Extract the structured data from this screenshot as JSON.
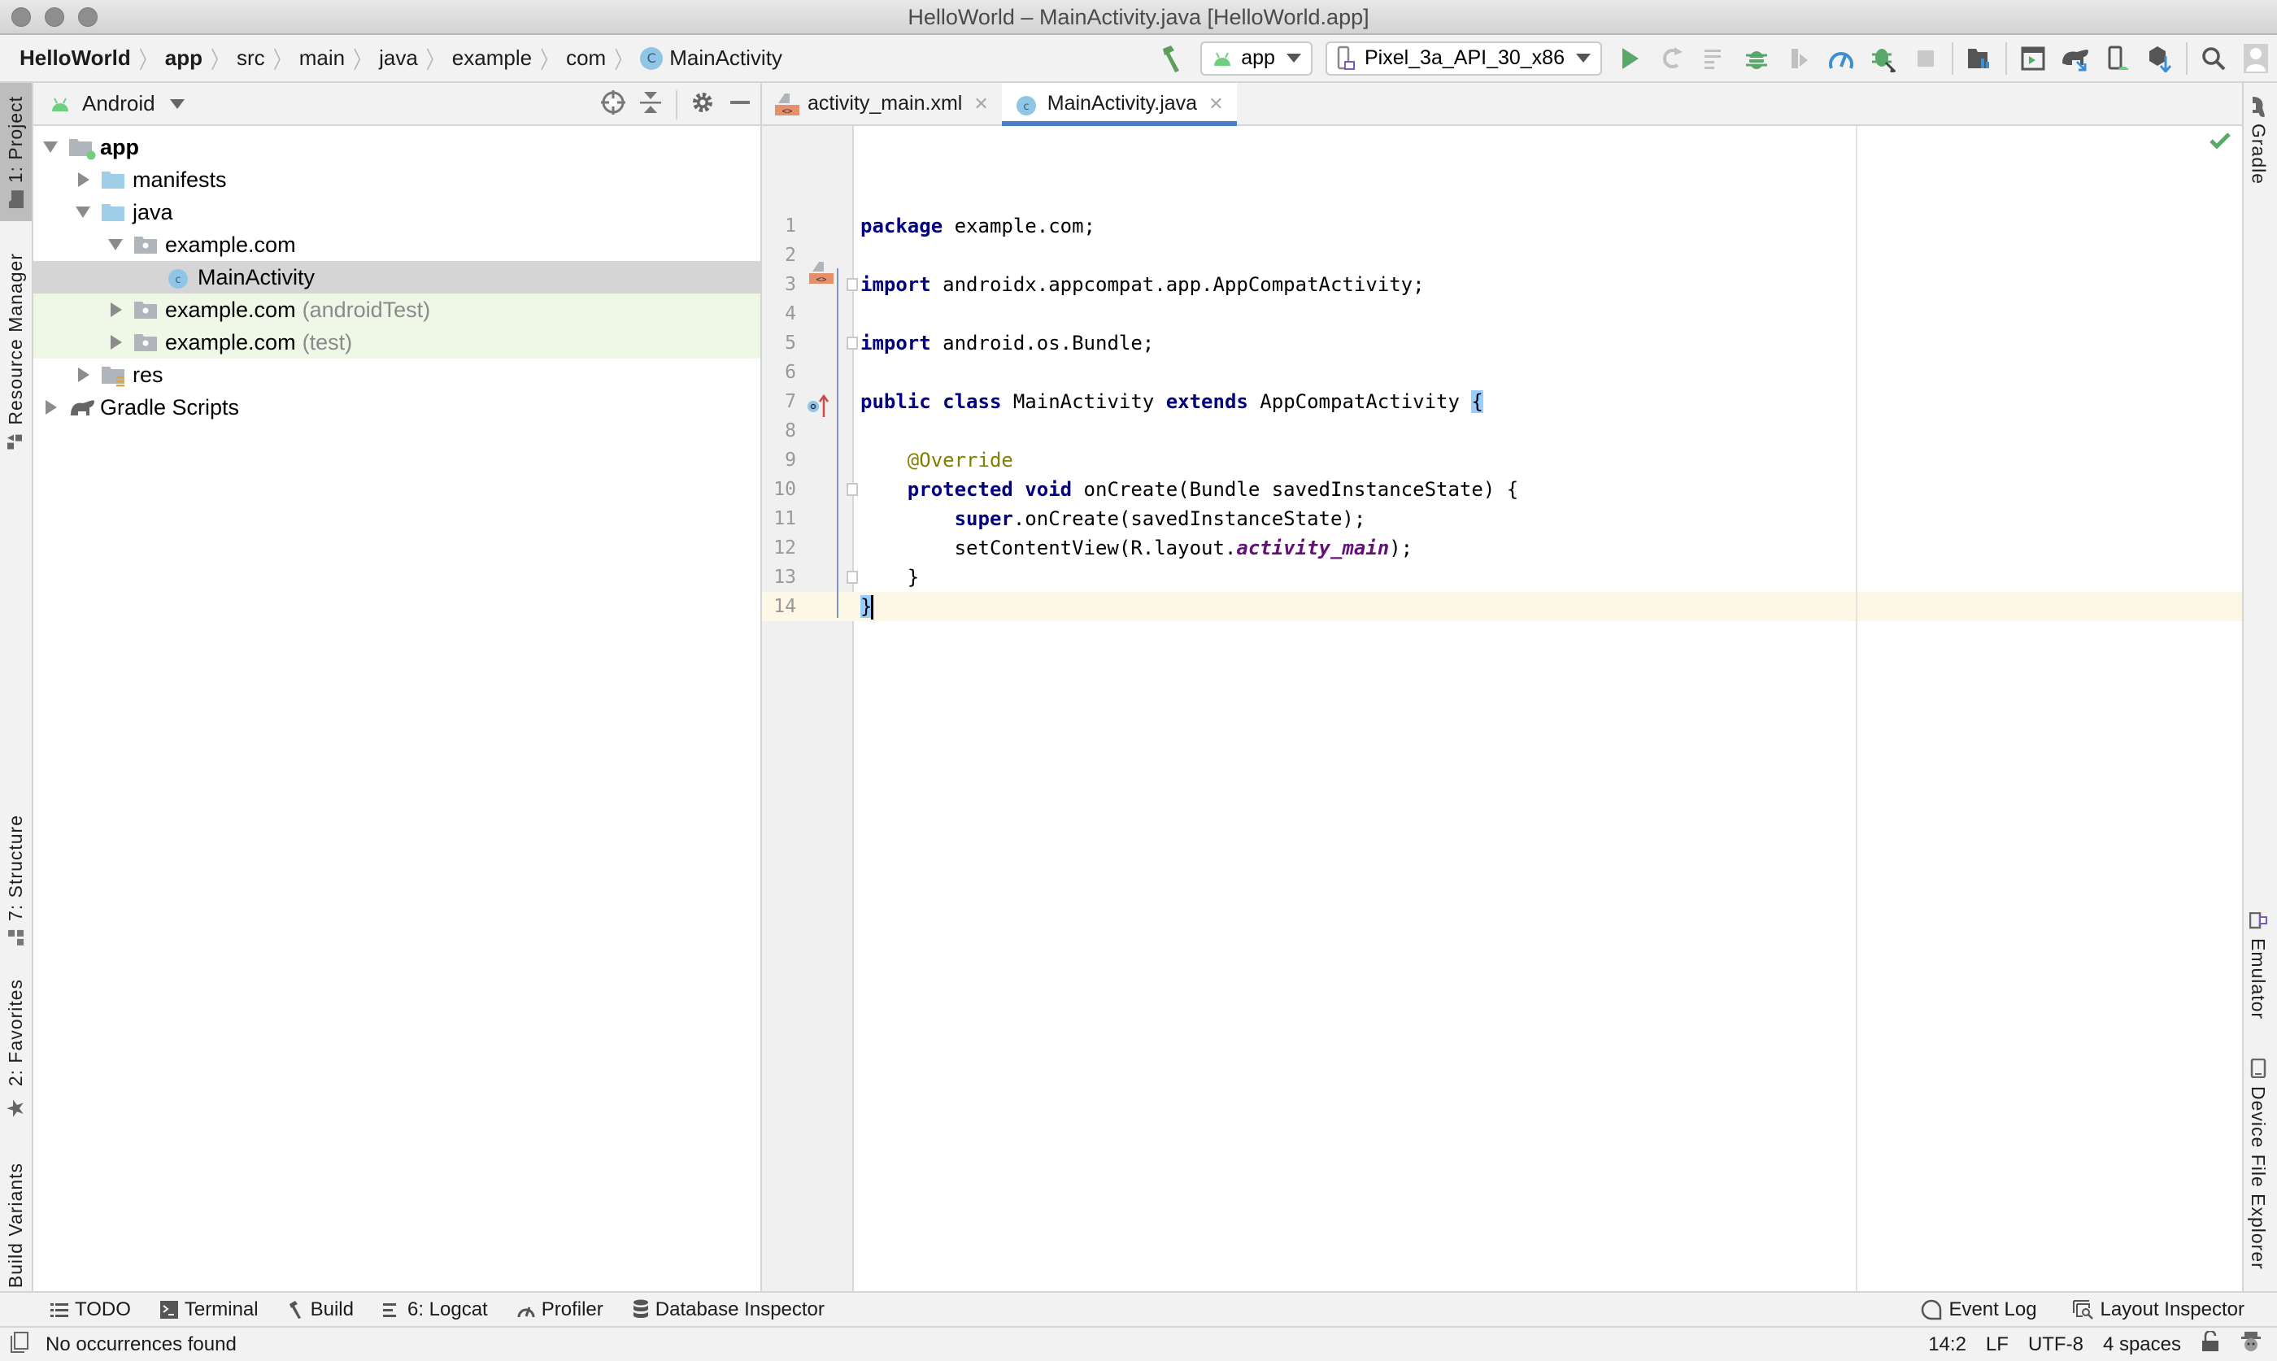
{
  "window": {
    "title": "HelloWorld – MainActivity.java [HelloWorld.app]"
  },
  "breadcrumbs": [
    {
      "label": "HelloWorld",
      "bold": true
    },
    {
      "label": "app",
      "bold": true
    },
    {
      "label": "src"
    },
    {
      "label": "main"
    },
    {
      "label": "java"
    },
    {
      "label": "example"
    },
    {
      "label": "com"
    },
    {
      "label": "MainActivity",
      "icon": "java-class-icon",
      "icon_glyph": "C"
    }
  ],
  "toolbar": {
    "run_config": "app",
    "device": "Pixel_3a_API_30_x86",
    "icons": [
      "hammer-icon",
      "run-icon",
      "apply-changes-icon",
      "apply-code-changes-icon",
      "debug-icon",
      "attach-debugger-icon",
      "profile-icon",
      "attach-debugger-to-process-icon",
      "stop-icon",
      "project-structure-icon",
      "avd-manager-icon",
      "sync-gradle-icon",
      "device-manager-icon",
      "sdk-manager-icon",
      "search-icon",
      "account-icon"
    ]
  },
  "left_stripe": {
    "project": "1: Project",
    "resource_manager": "Resource Manager",
    "structure": "7: Structure",
    "favorites": "2: Favorites",
    "build_variants": "Build Variants"
  },
  "right_stripe": {
    "gradle": "Gradle",
    "emulator": "Emulator",
    "device_file_explorer": "Device File Explorer"
  },
  "project_panel": {
    "view_mode": "Android",
    "tree": [
      {
        "label": "app",
        "depth": 0,
        "state": "open",
        "icon": "module-folder-icon",
        "bold": true
      },
      {
        "label": "manifests",
        "depth": 1,
        "state": "closed",
        "icon": "folder-icon"
      },
      {
        "label": "java",
        "depth": 1,
        "state": "open",
        "icon": "folder-icon"
      },
      {
        "label": "example.com",
        "depth": 2,
        "state": "open",
        "icon": "package-icon"
      },
      {
        "label": "MainActivity",
        "depth": 3,
        "state": "none",
        "icon": "java-class-icon",
        "selected": true
      },
      {
        "label": "example.com",
        "suffix": "(androidTest)",
        "depth": 2,
        "state": "closed",
        "icon": "package-icon",
        "test": true
      },
      {
        "label": "example.com",
        "suffix": "(test)",
        "depth": 2,
        "state": "closed",
        "icon": "package-icon",
        "test": true
      },
      {
        "label": "res",
        "depth": 1,
        "state": "closed",
        "icon": "res-folder-icon"
      },
      {
        "label": "Gradle Scripts",
        "depth": 0,
        "state": "closed",
        "icon": "gradle-icon"
      }
    ]
  },
  "editor": {
    "tabs": [
      {
        "label": "activity_main.xml",
        "icon": "xml-layout-icon",
        "active": false
      },
      {
        "label": "MainActivity.java",
        "icon": "java-class-icon",
        "active": true
      }
    ],
    "current_line": 14,
    "lines": [
      {
        "n": "1",
        "tokens": [
          {
            "t": "package",
            "c": "kw"
          },
          {
            "t": " example.com;"
          }
        ]
      },
      {
        "n": "2",
        "tokens": []
      },
      {
        "n": "3",
        "tokens": [
          {
            "t": "import",
            "c": "kw"
          },
          {
            "t": " androidx.appcompat.app.AppCompatActivity;"
          }
        ]
      },
      {
        "n": "4",
        "tokens": []
      },
      {
        "n": "5",
        "tokens": [
          {
            "t": "import",
            "c": "kw"
          },
          {
            "t": " android.os.Bundle;"
          }
        ]
      },
      {
        "n": "6",
        "tokens": []
      },
      {
        "n": "7",
        "tokens": [
          {
            "t": "public",
            "c": "kw"
          },
          {
            "t": " "
          },
          {
            "t": "class",
            "c": "kw"
          },
          {
            "t": " MainActivity "
          },
          {
            "t": "extends",
            "c": "kw"
          },
          {
            "t": " AppCompatActivity "
          },
          {
            "t": "{",
            "c": "brace-hl"
          }
        ]
      },
      {
        "n": "8",
        "tokens": []
      },
      {
        "n": "9",
        "tokens": [
          {
            "t": "    "
          },
          {
            "t": "@Override",
            "c": "ann"
          }
        ]
      },
      {
        "n": "10",
        "tokens": [
          {
            "t": "    "
          },
          {
            "t": "protected",
            "c": "kw"
          },
          {
            "t": " "
          },
          {
            "t": "void",
            "c": "kw"
          },
          {
            "t": " onCreate(Bundle savedInstanceState) {"
          }
        ]
      },
      {
        "n": "11",
        "tokens": [
          {
            "t": "        "
          },
          {
            "t": "super",
            "c": "kw"
          },
          {
            "t": ".onCreate(savedInstanceState);"
          }
        ]
      },
      {
        "n": "12",
        "tokens": [
          {
            "t": "        setContentView(R.layout."
          },
          {
            "t": "activity_main",
            "c": "fld"
          },
          {
            "t": ");"
          }
        ]
      },
      {
        "n": "13",
        "tokens": [
          {
            "t": "    }"
          }
        ]
      },
      {
        "n": "14",
        "tokens": [
          {
            "t": "}",
            "c": "brace-hl"
          },
          {
            "t": "",
            "c": "caret"
          }
        ]
      }
    ]
  },
  "bottom_tools": {
    "left": [
      {
        "label": "TODO",
        "icon": "todo-icon"
      },
      {
        "label": "Terminal",
        "icon": "terminal-icon"
      },
      {
        "label": "Build",
        "icon": "hammer-icon"
      },
      {
        "label": "6: Logcat",
        "icon": "logcat-icon"
      },
      {
        "label": "Profiler",
        "icon": "profiler-icon"
      },
      {
        "label": "Database Inspector",
        "icon": "database-icon"
      }
    ],
    "right": [
      {
        "label": "Event Log",
        "icon": "event-log-icon"
      },
      {
        "label": "Layout Inspector",
        "icon": "layout-inspector-icon"
      }
    ]
  },
  "status_bar": {
    "message": "No occurrences found",
    "position": "14:2",
    "line_separator": "LF",
    "encoding": "UTF-8",
    "indent": "4 spaces"
  },
  "colors": {
    "accent_tab": "#4a7fc1",
    "keyword": "#000080",
    "annotation": "#808000",
    "field": "#660e7a",
    "current_line": "#fdf8e6",
    "selection": "#d5d5d5",
    "test_bg": "#eff7e7",
    "android_green": "#6fcf7f"
  }
}
